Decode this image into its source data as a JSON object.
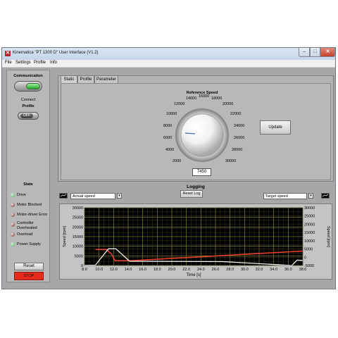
{
  "window": {
    "title": "Kinematica \"PT 1300 D\" User Interface (V1.2)",
    "min": "–",
    "max": "□",
    "close": "✕"
  },
  "menu": [
    "File",
    "Settings",
    "Profile",
    "Info"
  ],
  "left": {
    "communication": "Communication",
    "connect": "Connect",
    "profile": "Profile",
    "profile_toggle": "OFF",
    "state_title": "State",
    "states": [
      {
        "label": "Drive",
        "color": "#3cbf46"
      },
      {
        "label": "Motor Blocked",
        "color": "#7a1e18"
      },
      {
        "label": "Motor-driver Error",
        "color": "#7a1e18"
      },
      {
        "label": "Controller Overheated",
        "color": "#7a1e18"
      },
      {
        "label": "Overload",
        "color": "#7a1e18"
      },
      {
        "label": "Power Supply",
        "color": "#3cbf46"
      }
    ],
    "reset": "Reset",
    "stop": "STOP"
  },
  "tabs": [
    "Static",
    "Profile",
    "Parameter"
  ],
  "static": {
    "title": "Reference Speed",
    "dial_labels": [
      "2000",
      "4000",
      "6000",
      "8000",
      "10000",
      "12000",
      "14000",
      "16000",
      "18000",
      "20000",
      "22000",
      "24000",
      "26000",
      "28000",
      "30000"
    ],
    "speed_value": "7450",
    "update": "Update"
  },
  "logging": {
    "title": "Logging",
    "reset_log": "Reset Log",
    "left_select": "Actual speed",
    "right_select": "Target speed"
  },
  "chart_data": {
    "type": "line",
    "xlabel": "Time [s]",
    "ylabel_left": "Speed [rpm]",
    "ylabel_right": "Speed [rpm]",
    "xlim": [
      8.0,
      38.0
    ],
    "ylim_left": [
      0,
      30000
    ],
    "ylim_right": [
      -5000,
      30000
    ],
    "x_ticks": [
      "8.0",
      "10.0",
      "12.0",
      "14.0",
      "16.0",
      "18.0",
      "20.0",
      "22.0",
      "24.0",
      "26.0",
      "28.0",
      "30.0",
      "32.0",
      "34.0",
      "36.0",
      "38.0"
    ],
    "y_ticks_left": [
      "0",
      "5000",
      "10000",
      "15000",
      "20000",
      "25000",
      "30000"
    ],
    "y_ticks_right": [
      "-5000",
      "0",
      "5000",
      "10000",
      "15000",
      "20000",
      "25000",
      "30000"
    ],
    "grid": true,
    "series": [
      {
        "axis": "left",
        "color": "#e8402a",
        "x": [
          9.5,
          11.0,
          11.7,
          12.2,
          14.5,
          38.0
        ],
        "y": [
          8300,
          8300,
          6000,
          2500,
          2500,
          7500
        ]
      },
      {
        "axis": "left",
        "color": "#ffffff",
        "x": [
          8.0,
          9.5,
          11.3,
          12.3,
          14.2,
          27.0,
          36.5,
          37.2,
          38.0
        ],
        "y": [
          100,
          200,
          8700,
          8700,
          2200,
          2000,
          0,
          2800,
          2600
        ]
      }
    ]
  }
}
